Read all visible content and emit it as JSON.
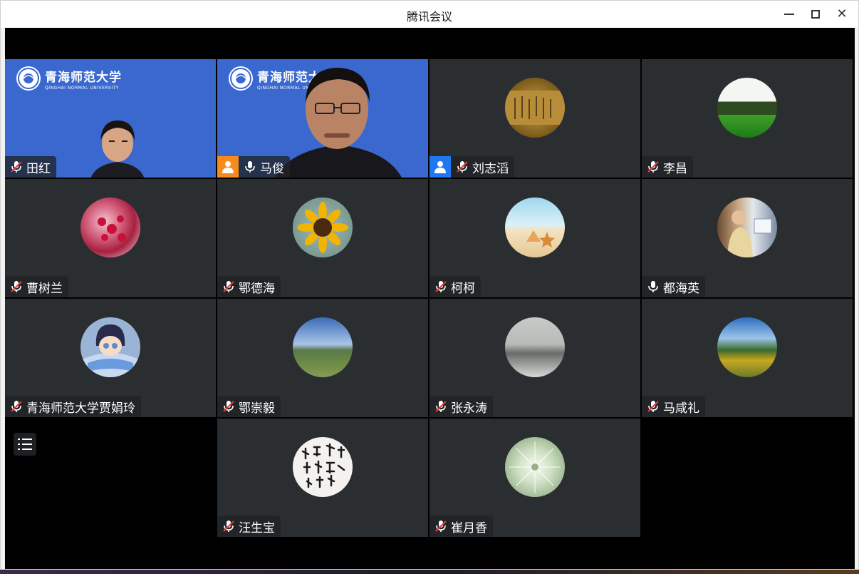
{
  "window": {
    "title": "腾讯会议"
  },
  "participants": [
    {
      "name": "田红",
      "mic": "muted",
      "type": "video",
      "role": ""
    },
    {
      "name": "马俊",
      "mic": "on",
      "type": "video",
      "role": "host"
    },
    {
      "name": "刘志滔",
      "mic": "muted",
      "type": "avatar",
      "role": "cohost"
    },
    {
      "name": "李昌",
      "mic": "muted",
      "type": "avatar",
      "role": ""
    },
    {
      "name": "曹树兰",
      "mic": "muted",
      "type": "avatar",
      "role": ""
    },
    {
      "name": "鄂德海",
      "mic": "muted",
      "type": "avatar",
      "role": ""
    },
    {
      "name": "柯柯",
      "mic": "muted",
      "type": "avatar",
      "role": ""
    },
    {
      "name": "都海英",
      "mic": "on",
      "type": "avatar",
      "role": ""
    },
    {
      "name": "青海师范大学贾娟玲",
      "mic": "muted",
      "type": "avatar",
      "role": ""
    },
    {
      "name": "鄂崇毅",
      "mic": "muted",
      "type": "avatar",
      "role": ""
    },
    {
      "name": "张永涛",
      "mic": "muted",
      "type": "avatar",
      "role": ""
    },
    {
      "name": "马咸礼",
      "mic": "muted",
      "type": "avatar",
      "role": ""
    },
    {
      "name": "汪生宝",
      "mic": "muted",
      "type": "avatar",
      "role": ""
    },
    {
      "name": "崔月香",
      "mic": "muted",
      "type": "avatar",
      "role": ""
    }
  ],
  "background_logo": {
    "cn": "青海师范大学",
    "en": "QINGHAI NORMAL UNIVERSITY"
  },
  "icons": {
    "mic_on": "microphone-icon",
    "mic_muted": "microphone-muted-icon",
    "host": "host-person-icon",
    "cohost": "cohost-person-icon",
    "list": "participant-list-icon"
  },
  "colors": {
    "tile_bg": "#2b2e31",
    "video_bg": "#3a68cf",
    "host_badge": "#f58a1f",
    "cohost_badge": "#1f78f2",
    "mute_red": "#e53935"
  }
}
